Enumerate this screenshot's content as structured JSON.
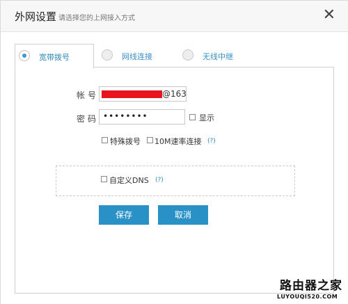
{
  "header": {
    "title": "外网设置",
    "subtitle": "请选择您的上网接入方式",
    "close_glyph": "✕"
  },
  "tabs": [
    {
      "label": "宽带拨号",
      "selected": true
    },
    {
      "label": "网线连接",
      "selected": false
    },
    {
      "label": "无线中继",
      "selected": false
    }
  ],
  "form": {
    "account_label": "帐号",
    "account_suffix": "@163",
    "password_label": "密码",
    "password_value": "••••••••",
    "show_label": "显示",
    "special_dial_label": "特殊拨号",
    "rate_label": "10M速率连接",
    "help_text": "(?)",
    "custom_dns_label": "自定义DNS",
    "dns_help_text": "(?)"
  },
  "buttons": {
    "save_label": "保存",
    "cancel_label": "取消"
  },
  "watermark": {
    "brand": "路由器之家",
    "url": "LUYOUQI520.COM"
  },
  "colors": {
    "accent": "#2a91c7",
    "redaction": "#e8141d"
  }
}
